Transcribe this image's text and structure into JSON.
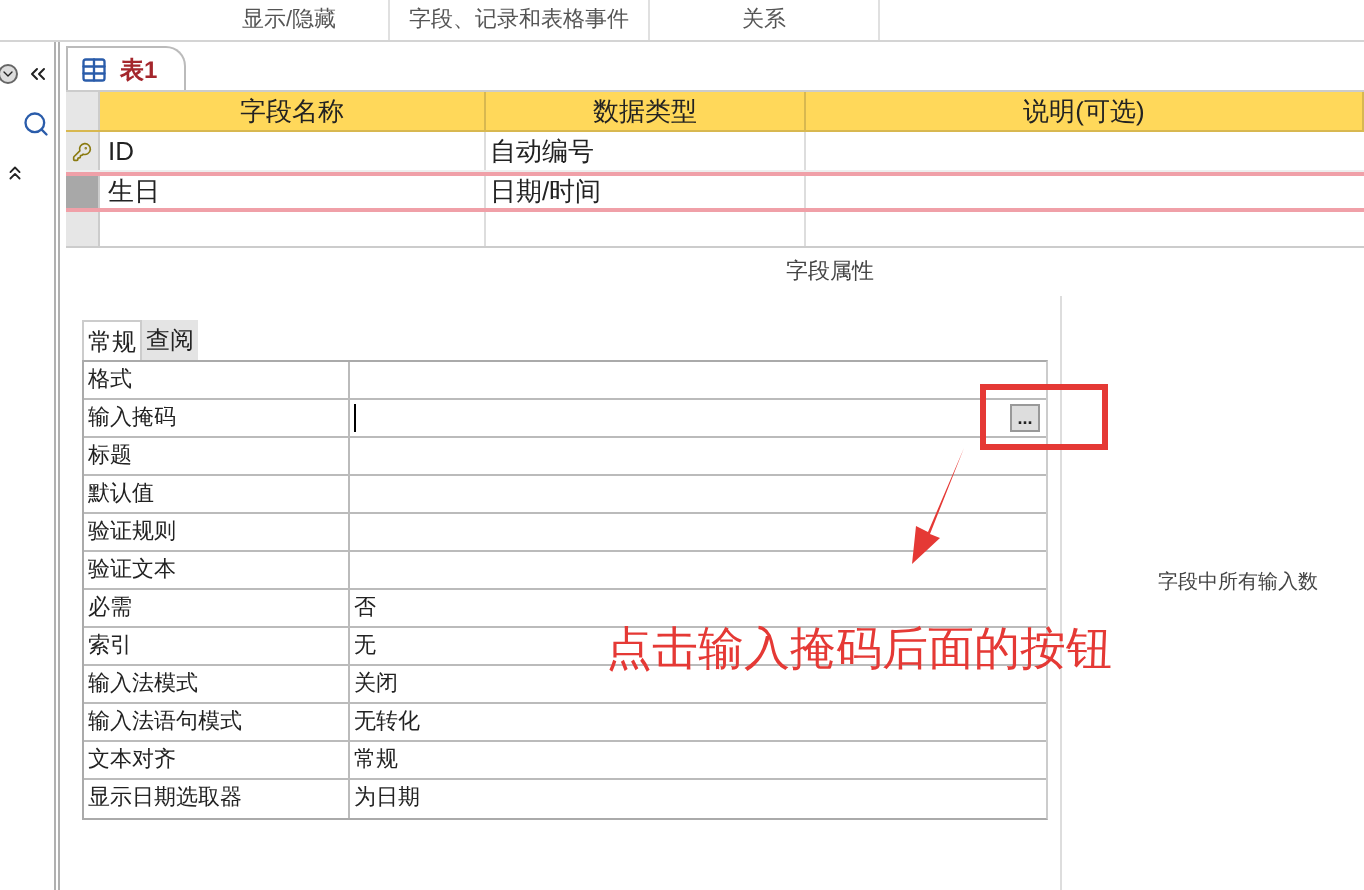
{
  "ribbon_groups": [
    "显示/隐藏",
    "字段、记录和表格事件",
    "关系"
  ],
  "document_tab": {
    "label": "表1",
    "selected": true
  },
  "design_grid": {
    "columns": [
      "字段名称",
      "数据类型",
      "说明(可选)"
    ],
    "rows": [
      {
        "field_name": "ID",
        "data_type": "自动编号",
        "primary_key": true,
        "selected": false
      },
      {
        "field_name": "生日",
        "data_type": "日期/时间",
        "primary_key": false,
        "selected": true
      }
    ]
  },
  "field_properties": {
    "title": "字段属性",
    "tabs": [
      {
        "label": "常规",
        "selected": true
      },
      {
        "label": "查阅",
        "selected": false
      }
    ],
    "rows": [
      {
        "label": "格式",
        "kind": "plain"
      },
      {
        "label": "输入掩码",
        "kind": "builder",
        "builder_button": "..."
      },
      {
        "label": "标题",
        "kind": "plain"
      },
      {
        "label": "默认值",
        "kind": "plain"
      },
      {
        "label": "验证规则",
        "kind": "plain"
      },
      {
        "label": "验证文本",
        "kind": "plain"
      },
      {
        "label": "必需",
        "value": "否",
        "kind": "plain"
      },
      {
        "label": "索引",
        "value": "无",
        "kind": "plain"
      },
      {
        "label": "输入法模式",
        "value": "关闭",
        "kind": "plain"
      },
      {
        "label": "输入法语句模式",
        "value": "无转化",
        "kind": "plain"
      },
      {
        "label": "文本对齐",
        "value": "常规",
        "kind": "plain"
      },
      {
        "label": "显示日期选取器",
        "value": "为日期",
        "kind": "plain"
      }
    ],
    "help_text": "字段中所有输入数"
  },
  "annotation": {
    "text": "点击输入掩码后面的按钮"
  }
}
